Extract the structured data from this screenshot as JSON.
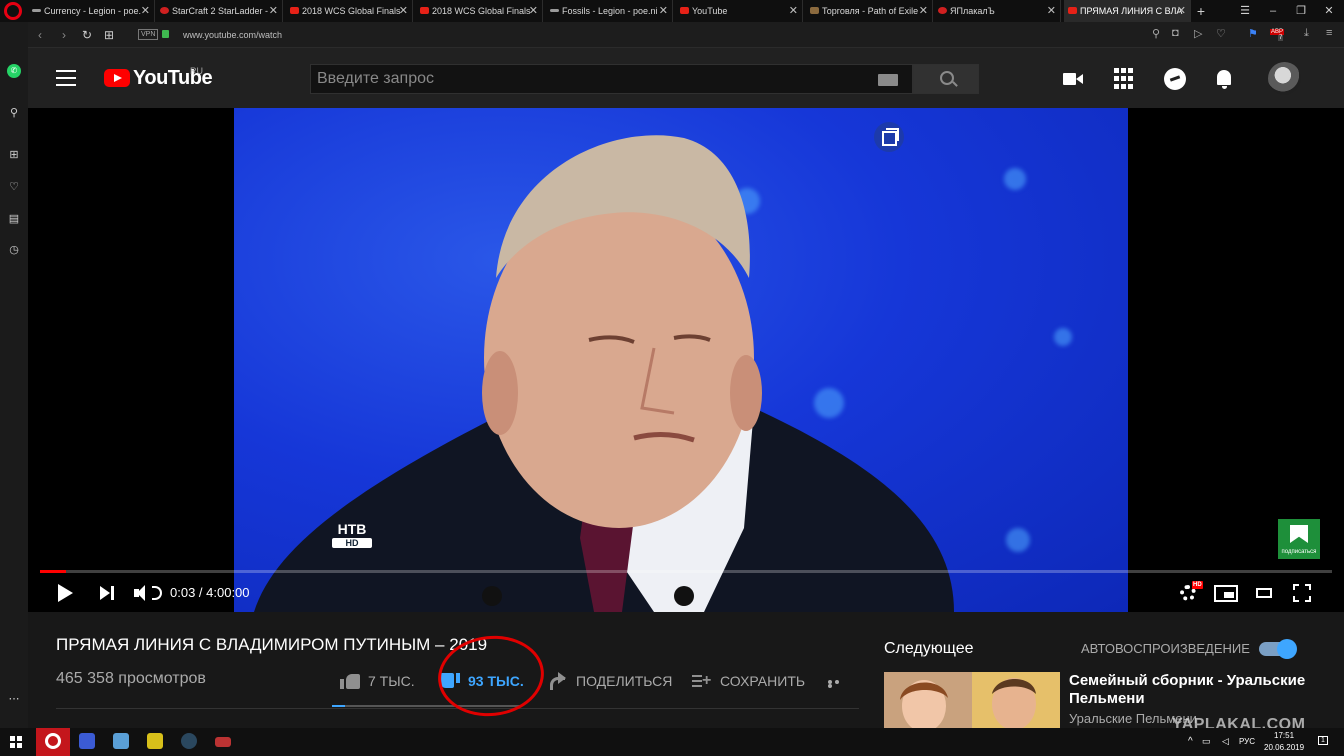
{
  "browser": {
    "tabs": [
      {
        "label": "Currency - Legion - poe.",
        "icon": "poe-icon"
      },
      {
        "label": "StarCraft 2 StarLadder - ",
        "icon": "starcraft-icon"
      },
      {
        "label": "2018 WCS Global Finals",
        "icon": "youtube-icon"
      },
      {
        "label": "2018 WCS Global Finals",
        "icon": "youtube-icon"
      },
      {
        "label": "Fossils - Legion - poe.ni",
        "icon": "poe-icon"
      },
      {
        "label": "YouTube",
        "icon": "youtube-icon"
      },
      {
        "label": "Торговля - Path of Exile",
        "icon": "path-of-exile-icon"
      },
      {
        "label": "ЯПлакалЪ",
        "icon": "yaplakal-icon"
      },
      {
        "label": "ПРЯМАЯ ЛИНИЯ С ВЛА",
        "icon": "youtube-icon",
        "active": true
      }
    ],
    "new_tab_label": "+",
    "close_glyph": "✕",
    "vpn_label": "VPN",
    "url": "www.youtube.com/watch",
    "extension_badge": "ABP",
    "extension_count": "7"
  },
  "youtube": {
    "logo_text": "YouTube",
    "region": "RU",
    "search_placeholder": "Введите запрос",
    "video": {
      "channel_logo": "НТВ",
      "channel_logo_sub": "HD",
      "subscribe_badge": "подписаться",
      "time_current": "0:03",
      "time_total": "4:00:00",
      "time_display": "0:03 / 4:00:00",
      "progress_fraction": 0.0002,
      "hd_label": "HD"
    },
    "title": "ПРЯМАЯ ЛИНИЯ С ВЛАДИМИРОМ ПУТИНЫМ – 2019",
    "views": "465 358 просмотров",
    "actions": {
      "like": "7 ТЫС.",
      "dislike": "93 ТЫС.",
      "share": "ПОДЕЛИТЬСЯ",
      "save": "СОХРАНИТЬ"
    },
    "like_ratio_fraction": 0.07,
    "sidebar": {
      "next_label": "Следующее",
      "autoplay_label": "АВТОВОСПРОИЗВЕДЕНИЕ",
      "autoplay_on": true,
      "recommended": {
        "title": "Семейный сборник - Уральские Пельмени",
        "channel": "Уральские Пельмени"
      }
    }
  },
  "watermark": "YAPLAKAL.COM",
  "taskbar": {
    "language": "РУС",
    "time": "17:51",
    "date": "20.06.2019",
    "notification_count": "1"
  },
  "colors": {
    "accent_red": "#ff0000",
    "accent_blue": "#3ea6ff",
    "annotation_red": "#e00000",
    "studio_blue": "#1637d8"
  }
}
